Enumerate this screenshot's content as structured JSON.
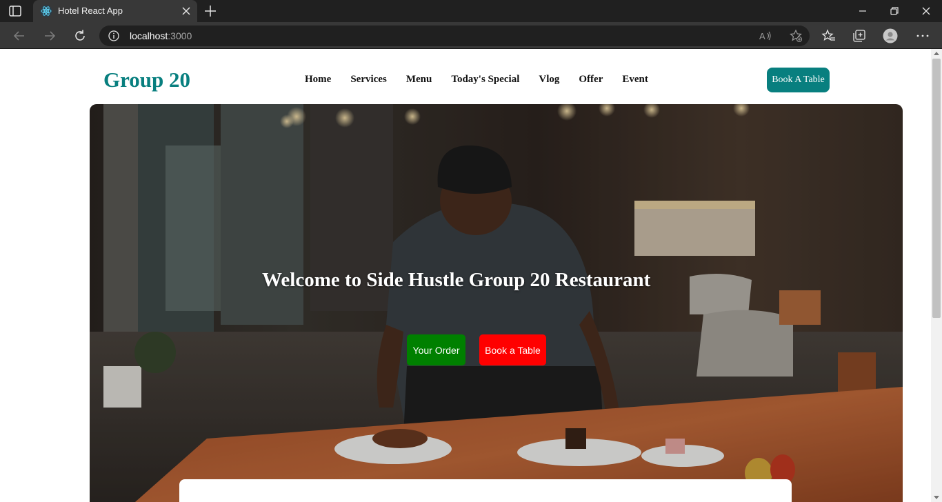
{
  "browser": {
    "tab_title": "Hotel React App",
    "url_host": "localhost",
    "url_port": ":3000"
  },
  "page": {
    "brand": "Group 20",
    "nav": [
      "Home",
      "Services",
      "Menu",
      "Today's Special",
      "Vlog",
      "Offer",
      "Event"
    ],
    "book_top_label": "Book A Table",
    "hero": {
      "title": "Welcome to Side Hustle Group 20 Restaurant",
      "order_label": "Your Order",
      "book_label": "Book a Table"
    }
  },
  "colors": {
    "brand": "#087f7f",
    "order_button": "#008000",
    "book_button": "#ff0000"
  }
}
